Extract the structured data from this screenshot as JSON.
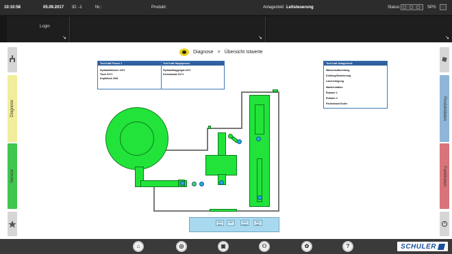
{
  "status_bar": {
    "time": "10:10:58",
    "date": "05.09.2017",
    "id_label": "ID: -1",
    "nr_label": "Nr.:",
    "produkt_label": "Produkt:",
    "anlagenteil_label": "Anlagenteil:",
    "anlagenteil_value": "Leitsteuerung",
    "status_label": "Status:",
    "sps_label": "SPS:"
  },
  "sub_bar": {
    "login_label": "Login",
    "arrow": "↘"
  },
  "breadcrumb": {
    "section": "Diagnose",
    "separator": ">",
    "page": "Übersicht Istwerte"
  },
  "left_tabs": {
    "diagnose": "Diagnose",
    "service": "Service",
    "favorites_icon": "star-icon"
  },
  "right_tabs": {
    "produktdaten": "Produktdaten",
    "funktionen": "Funktionen"
  },
  "tables": {
    "presse": {
      "header1": "Text Kraft Presse 1",
      "header2": "Text Kraft Hauptpresse",
      "col1": [
        "Hydraulikkissen 4471",
        "Tisch 5171",
        "Kopfstück 4391"
      ],
      "col2": [
        "Hydraulikaggregat 4471",
        "Klemmkaste 5171"
      ]
    },
    "anlagenteile": {
      "header": "Text Kraft Anlagenteile",
      "items": [
        "Wasseraufbereitung",
        "Kühlung/Schmierung",
        "Laserreinigung",
        "Markierstation",
        "Roboter 1",
        "Roboter 2",
        "Förderband Koller"
      ]
    }
  },
  "conveyor": {
    "cells": [
      "Nass Gurt",
      "Lager",
      "Drain Power",
      "Weg Aufn."
    ]
  },
  "bottom_bar": {
    "icons": [
      "home-icon",
      "globe-icon",
      "camera-icon",
      "network-icon",
      "settings-icon",
      "help-icon"
    ],
    "help_glyph": "?",
    "brand": "SCHULER"
  },
  "colors": {
    "machine_green": "#22e33a",
    "sensor_blue": "#2aa6e0",
    "header_blue": "#2f5f9e"
  }
}
